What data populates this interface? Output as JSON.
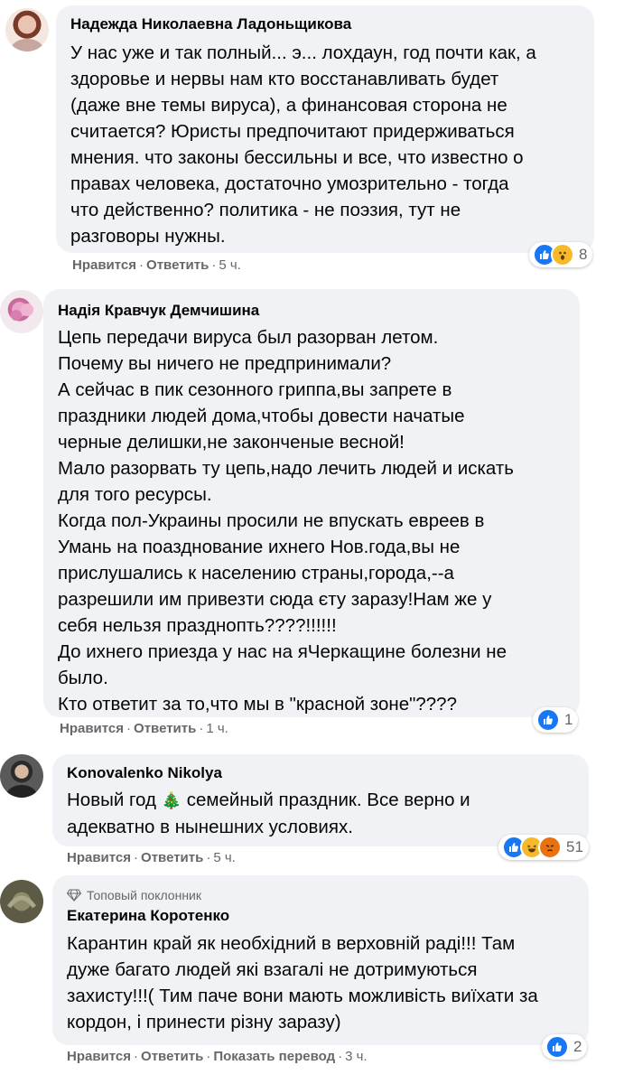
{
  "comments": [
    {
      "author": "Надежда Николаевна Ладоньщикова",
      "lines": [
        "У нас уже и так полный... э... лохдаун, год почти как, а",
        "здоровье и нервы нам кто восстанавливать будет",
        "(даже вне темы вируса), а финансовая сторона не",
        "считается? Юристы предпочитают придерживаться",
        "мнения. что законы бессильны и все, что известно о",
        "правах человека, достаточно умозрительно - тогда",
        "что действенно? политика - не поэзия, тут не",
        "разговоры нужны."
      ],
      "like": "Нравится",
      "reply": "Ответить",
      "time": "5 ч.",
      "reactions": [
        "like-icon",
        "wow-icon"
      ],
      "reaction_count": "8"
    },
    {
      "author": "Надія Кравчук Демчишина",
      "lines": [
        "Цепь передачи вируса был разорван летом.",
        "Почему вы ничего не предпринимали?",
        "А сейчас в пик сезонного гриппа,вы запрете в",
        "праздники людей дома,чтобы довести начатые",
        "черные делишки,не законченые весной!",
        "Мало разорвать ту цепь,надо лечить людей и искать",
        "для того ресурсы.",
        "Когда пол-Украины просили не впускать евреев в",
        "Умань на поазднование ихнего Нов.года,вы не",
        "прислушались к населению страны,города,--а",
        "разрешили им привезти сюда єту заразу!Нам же у",
        "себя нельзя празднопть????!!!!!!",
        "До ихнего приезда у нас на яЧеркащине болезни не",
        "было.",
        "Кто ответит за то,что мы в \"красной зоне\"????"
      ],
      "like": "Нравится",
      "reply": "Ответить",
      "time": "1 ч.",
      "reactions": [
        "like-icon"
      ],
      "reaction_count": "1"
    },
    {
      "author": "Konovalenko Nikolya",
      "line1_before": "Новый год",
      "line1_after": "семейный праздник. Все верно и",
      "line2": "адекватно в нынешних условиях.",
      "like": "Нравится",
      "reply": "Ответить",
      "time": "5 ч.",
      "reactions": [
        "like-icon",
        "haha-icon",
        "angry-icon"
      ],
      "reaction_count": "51"
    },
    {
      "badge": "Топовый поклонник",
      "author": "Екатерина Коротенко",
      "lines": [
        "Карантин край як необхідний в верховній раді!!! Там",
        "дуже багато людей які взагалі не дотримуються",
        "захисту!!!( Тим паче вони мають можливість виїхати за",
        "кордон, і принести різну заразу)"
      ],
      "like": "Нравится",
      "reply": "Ответить",
      "translate": "Показать перевод",
      "time": "3 ч.",
      "reactions": [
        "like-icon"
      ],
      "reaction_count": "2"
    }
  ],
  "colors": {
    "bubble": "#f0f2f5",
    "meta": "#65676b",
    "like": "#1877f2",
    "wow": "#f7b928",
    "angry": "#e9710f"
  }
}
